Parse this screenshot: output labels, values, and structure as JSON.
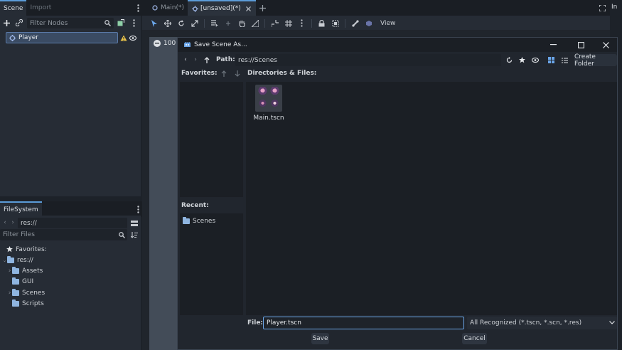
{
  "scene_dock": {
    "tabs": [
      "Scene",
      "Import"
    ],
    "filter_placeholder": "Filter Nodes",
    "nodes": [
      {
        "label": "Player"
      }
    ]
  },
  "filesystem_dock": {
    "tab": "FileSystem",
    "path": "res://",
    "filter_placeholder": "Filter Files",
    "tree": {
      "favorites": "Favorites:",
      "root": "res://",
      "folders": [
        "Assets",
        "GUI",
        "Scenes",
        "Scripts"
      ]
    }
  },
  "editor": {
    "scene_tabs": [
      "Main(*)",
      "[unsaved](*)"
    ],
    "toolbar_view_label": "View",
    "zoom_label": "100",
    "right_panel_tab": "In"
  },
  "dialog": {
    "title": "Save Scene As...",
    "path_label": "Path:",
    "path_value": "res://Scenes",
    "create_folder_label": "Create Folder",
    "favorites_label": "Favorites:",
    "dirs_files_label": "Directories & Files:",
    "recent_label": "Recent:",
    "recent_items": [
      "Scenes"
    ],
    "files": [
      {
        "name": "Main.tscn"
      }
    ],
    "file_label": "File:",
    "file_value": "Player.tscn",
    "filter_select": "All Recognized (*.tscn, *.scn, *.res)",
    "save_label": "Save",
    "cancel_label": "Cancel"
  },
  "colors": {
    "accent": "#5b9bd8",
    "background": "#1d2229",
    "panel": "#262c35",
    "warning": "#e8c34a"
  }
}
